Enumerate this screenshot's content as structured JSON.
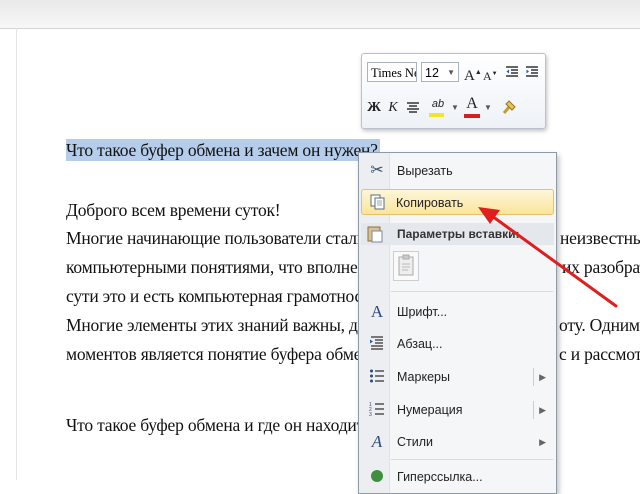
{
  "document": {
    "lines": [
      "Что такое буфер обмена и зачем он нужен?",
      "Доброго всем времени суток!",
      "Многие начинающие пользователи сталк",
      "компьютерными понятиями, что вполне н",
      "сути это и есть компьютерная грамотност",
      "Многие элементы этих знаний важны, да",
      "моментов является понятие буфера обмен",
      "Что такое буфер обмена и где он находит"
    ],
    "right_fragments": [
      "неизвестны",
      "их разобрать",
      "оту. Одним",
      "с и рассмотр"
    ]
  },
  "mini_toolbar": {
    "font_name": "Times Ne",
    "font_size": "12",
    "grow_label": "A",
    "shrink_label": "A",
    "bold": "Ж",
    "italic": "К",
    "highlight_label": "ab",
    "font_color_label": "A",
    "highlight_color": "#f5e52a",
    "font_color": "#d42020"
  },
  "context_menu": {
    "items": [
      {
        "label": "Вырезать",
        "icon": "scissors-icon"
      },
      {
        "label": "Копировать",
        "icon": "copy-icon"
      },
      {
        "label": "Параметры вставки:",
        "icon": "paste-icon"
      },
      {
        "label": "Шрифт...",
        "icon": "font-icon"
      },
      {
        "label": "Абзац...",
        "icon": "paragraph-icon"
      },
      {
        "label": "Маркеры",
        "icon": "bullets-icon"
      },
      {
        "label": "Нумерация",
        "icon": "numbering-icon"
      },
      {
        "label": "Стили",
        "icon": "styles-icon"
      },
      {
        "label": "Гиперссылка...",
        "icon": "hyperlink-icon"
      }
    ],
    "highlight_color": "#fbe59b"
  },
  "annotation": {
    "arrow_color": "#e01e1e"
  }
}
